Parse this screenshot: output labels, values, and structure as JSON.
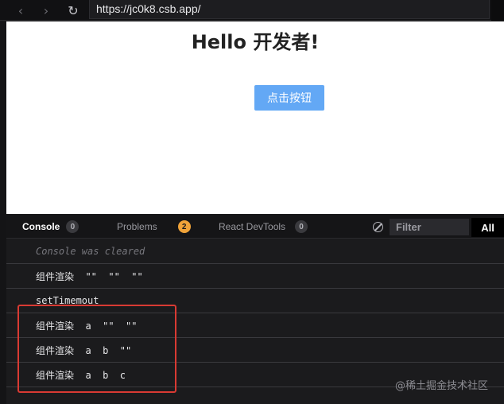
{
  "browser": {
    "url": "https://jc0k8.csb.app/",
    "back_icon": "chevron-left-icon",
    "forward_icon": "chevron-right-icon",
    "reload_icon": "reload-icon"
  },
  "preview": {
    "heading": "Hello 开发者!",
    "button_label": "点击按钮",
    "button_color": "#63a8f5"
  },
  "devtools": {
    "tabs": [
      {
        "label": "Console",
        "count": "0",
        "active": true
      },
      {
        "label": "Problems",
        "count": "2",
        "active": false
      },
      {
        "label": "React DevTools",
        "count": "0",
        "active": false
      }
    ],
    "filter_placeholder": "Filter",
    "level_toggle": "All",
    "clear_icon": "clear-console-icon",
    "logs": [
      "Console was cleared",
      "组件渲染  \"\"  \"\"  \"\"",
      "setTimemout",
      "组件渲染  a  \"\"  \"\"",
      "组件渲染  a  b  \"\"",
      "组件渲染  a  b  c"
    ]
  },
  "annotation": {
    "highlight_color": "#d93a33"
  },
  "watermark": "@稀土掘金技术社区"
}
